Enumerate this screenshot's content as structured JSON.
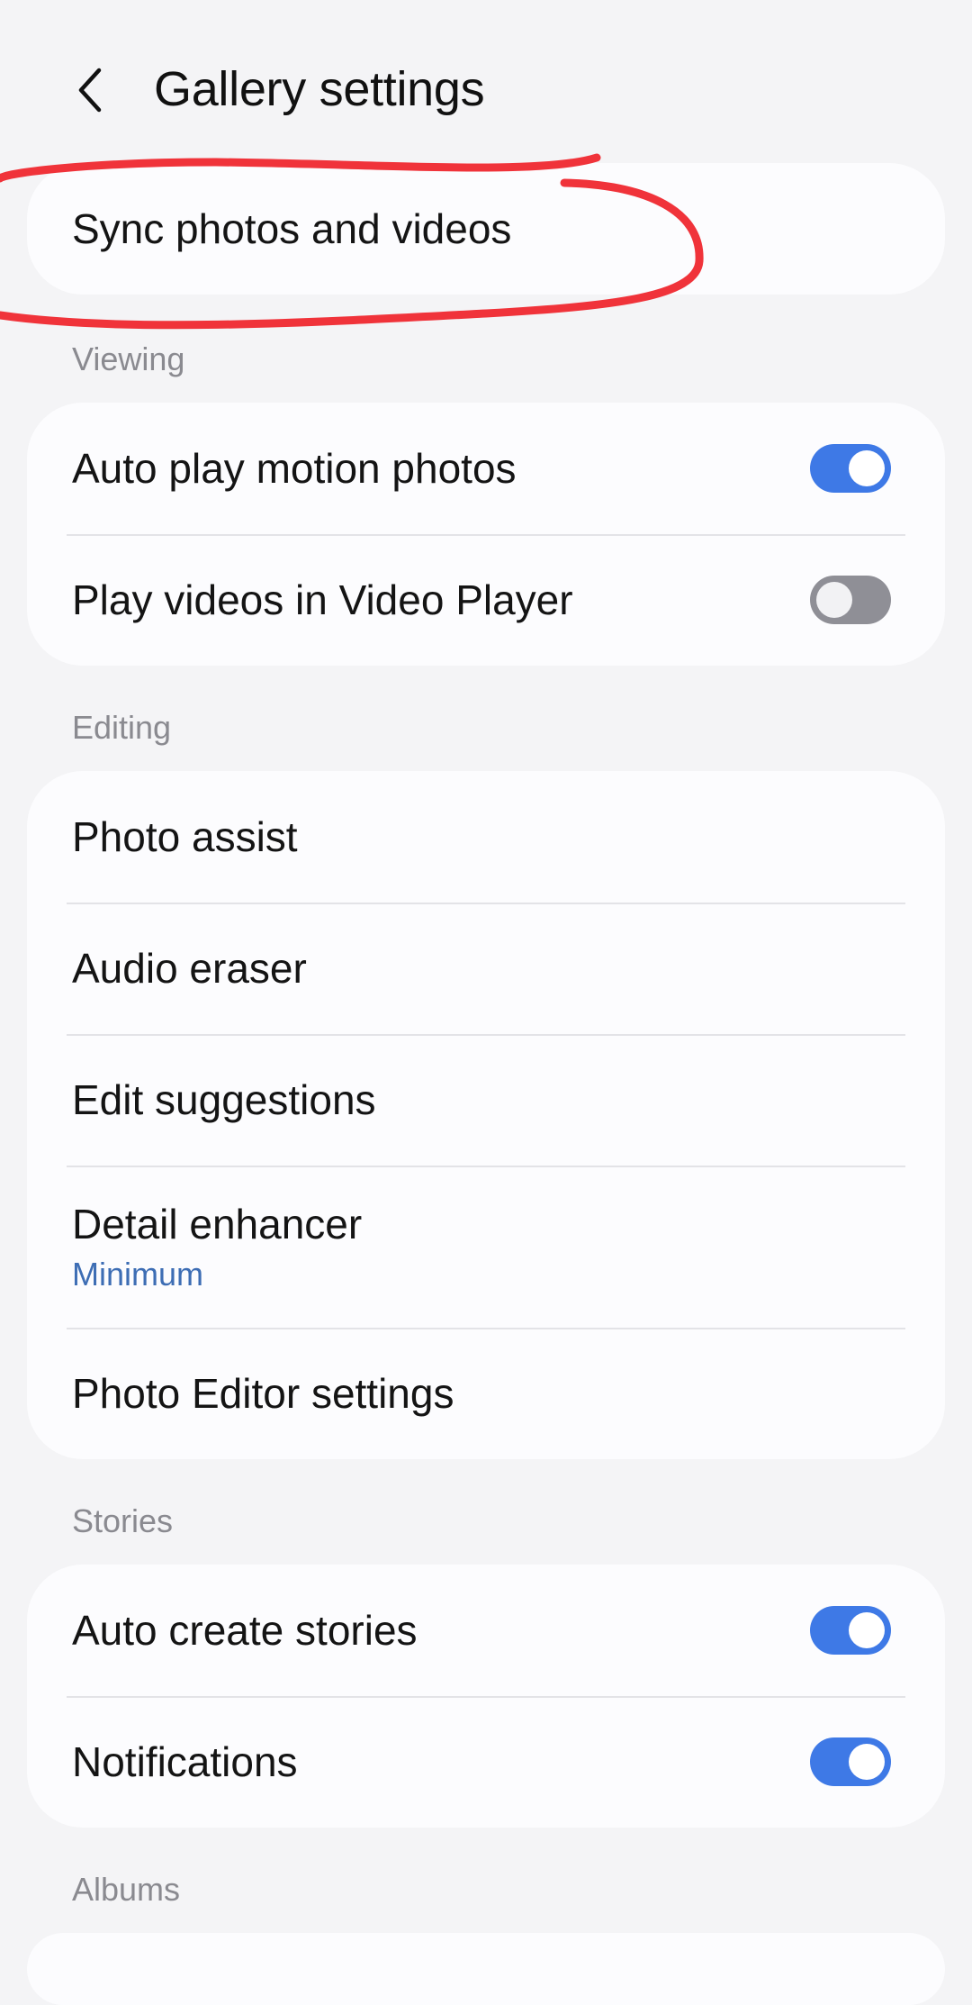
{
  "header": {
    "title": "Gallery settings",
    "back_icon": "chevron-left-icon"
  },
  "sync": {
    "label": "Sync photos and videos"
  },
  "viewing": {
    "section_label": "Viewing",
    "items": [
      {
        "label": "Auto play motion photos",
        "toggle": true
      },
      {
        "label": "Play videos in Video Player",
        "toggle": false
      }
    ]
  },
  "editing": {
    "section_label": "Editing",
    "items": [
      {
        "label": "Photo assist"
      },
      {
        "label": "Audio eraser"
      },
      {
        "label": "Edit suggestions"
      },
      {
        "label": "Detail enhancer",
        "sub": "Minimum"
      },
      {
        "label": "Photo Editor settings"
      }
    ]
  },
  "stories": {
    "section_label": "Stories",
    "items": [
      {
        "label": "Auto create stories",
        "toggle": true
      },
      {
        "label": "Notifications",
        "toggle": true
      }
    ]
  },
  "albums": {
    "section_label": "Albums"
  },
  "colors": {
    "accent": "#3e79e6",
    "annotation": "#f0333a",
    "subtext": "#3d6db4"
  }
}
